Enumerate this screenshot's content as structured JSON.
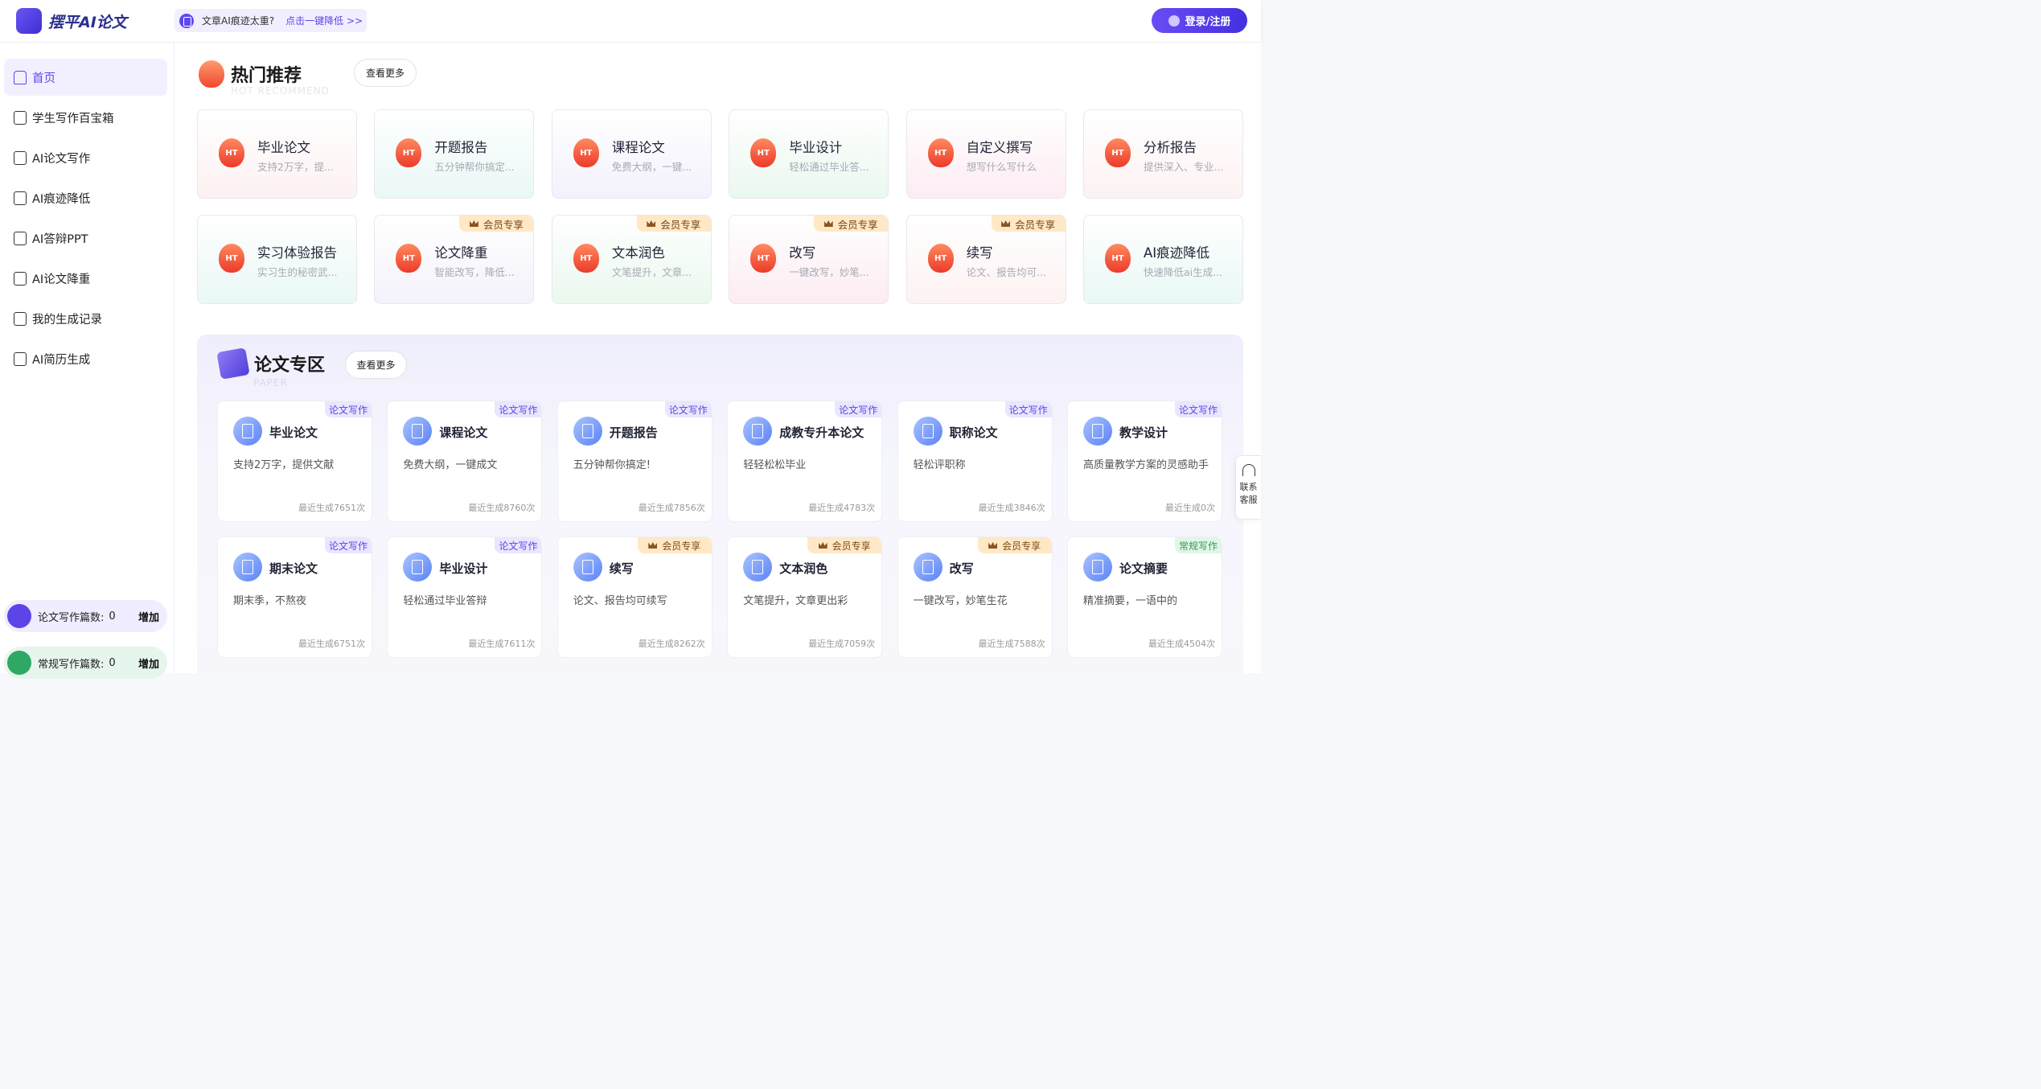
{
  "app": {
    "name": "摆平AI论文"
  },
  "notice": {
    "text": "文章AI痕迹太重?",
    "link": "点击一键降低 >>"
  },
  "login": {
    "label": "登录/注册"
  },
  "sidebar": {
    "items": [
      {
        "label": "首页",
        "active": true,
        "icon": "home-icon"
      },
      {
        "label": "学生写作百宝箱",
        "icon": "ai-book-icon"
      },
      {
        "label": "AI论文写作",
        "icon": "ai-book-icon"
      },
      {
        "label": "AI痕迹降低",
        "icon": "ai-doc-icon"
      },
      {
        "label": "AI答辩PPT",
        "icon": "ai-doc-icon"
      },
      {
        "label": "AI论文降重",
        "icon": "ai-doc-icon"
      },
      {
        "label": "我的生成记录",
        "icon": "record-icon"
      },
      {
        "label": "AI简历生成",
        "icon": "resume-icon"
      }
    ],
    "quota": [
      {
        "label": "论文写作篇数:",
        "count": "0",
        "action": "增加",
        "color": "#5b45e8"
      },
      {
        "label": "常规写作篇数:",
        "count": "0",
        "action": "增加",
        "color": "#2fa866"
      }
    ]
  },
  "hot": {
    "title": "热门推荐",
    "subtitle": "HOT RECOMMEND",
    "more": "查看更多",
    "icon_text": "HT",
    "vip_label": "会员专享",
    "cards": [
      {
        "title": "毕业论文",
        "desc": "支持2万字，提...",
        "bg": "#fdf1f1",
        "vip": false
      },
      {
        "title": "开题报告",
        "desc": "五分钟帮你搞定...",
        "bg": "#e9f8f6",
        "vip": false
      },
      {
        "title": "课程论文",
        "desc": "免费大纲，一键...",
        "bg": "#f3f1fc",
        "vip": false
      },
      {
        "title": "毕业设计",
        "desc": "轻松通过毕业答...",
        "bg": "#eaf8ee",
        "vip": false
      },
      {
        "title": "自定义撰写",
        "desc": "想写什么写什么",
        "bg": "#fcecf3",
        "vip": false
      },
      {
        "title": "分析报告",
        "desc": "提供深入、专业...",
        "bg": "#fdf2f2",
        "vip": false
      },
      {
        "title": "实习体验报告",
        "desc": "实习生的秘密武...",
        "bg": "#e9f8f6",
        "vip": false
      },
      {
        "title": "论文降重",
        "desc": "智能改写，降低...",
        "bg": "#f4f2fb",
        "vip": true
      },
      {
        "title": "文本润色",
        "desc": "文笔提升，文章...",
        "bg": "#eaf8ee",
        "vip": true
      },
      {
        "title": "改写",
        "desc": "一键改写，妙笔...",
        "bg": "#fcecf2",
        "vip": true
      },
      {
        "title": "续写",
        "desc": "论文、报告均可...",
        "bg": "#fdf2f2",
        "vip": true
      },
      {
        "title": "AI痕迹降低",
        "desc": "快速降低ai生成...",
        "bg": "#e9f8f6",
        "vip": false
      }
    ]
  },
  "paper": {
    "title": "论文专区",
    "subtitle": "PAPER",
    "more": "查看更多",
    "cards": [
      {
        "title": "毕业论文",
        "desc": "支持2万字，提供文献",
        "count": "最近生成7651次",
        "tag": "论文写作",
        "tag_type": "blue"
      },
      {
        "title": "课程论文",
        "desc": "免费大纲，一键成文",
        "count": "最近生成8760次",
        "tag": "论文写作",
        "tag_type": "blue"
      },
      {
        "title": "开题报告",
        "desc": "五分钟帮你搞定!",
        "count": "最近生成7856次",
        "tag": "论文写作",
        "tag_type": "blue"
      },
      {
        "title": "成教专升本论文",
        "desc": "轻轻松松毕业",
        "count": "最近生成4783次",
        "tag": "论文写作",
        "tag_type": "blue"
      },
      {
        "title": "职称论文",
        "desc": "轻松评职称",
        "count": "最近生成3846次",
        "tag": "论文写作",
        "tag_type": "blue"
      },
      {
        "title": "教学设计",
        "desc": "高质量教学方案的灵感助手",
        "count": "最近生成0次",
        "tag": "论文写作",
        "tag_type": "blue"
      },
      {
        "title": "期末论文",
        "desc": "期末季，不熬夜",
        "count": "最近生成6751次",
        "tag": "论文写作",
        "tag_type": "blue"
      },
      {
        "title": "毕业设计",
        "desc": "轻松通过毕业答辩",
        "count": "最近生成7611次",
        "tag": "论文写作",
        "tag_type": "blue"
      },
      {
        "title": "续写",
        "desc": "论文、报告均可续写",
        "count": "最近生成8262次",
        "tag": "会员专享",
        "tag_type": "vip"
      },
      {
        "title": "文本润色",
        "desc": "文笔提升，文章更出彩",
        "count": "最近生成7059次",
        "tag": "会员专享",
        "tag_type": "vip"
      },
      {
        "title": "改写",
        "desc": "一键改写，妙笔生花",
        "count": "最近生成7588次",
        "tag": "会员专享",
        "tag_type": "vip"
      },
      {
        "title": "论文摘要",
        "desc": "精准摘要，一语中的",
        "count": "最近生成4504次",
        "tag": "常规写作",
        "tag_type": "green"
      }
    ]
  },
  "support": {
    "line1": "联系",
    "line2": "客服"
  }
}
